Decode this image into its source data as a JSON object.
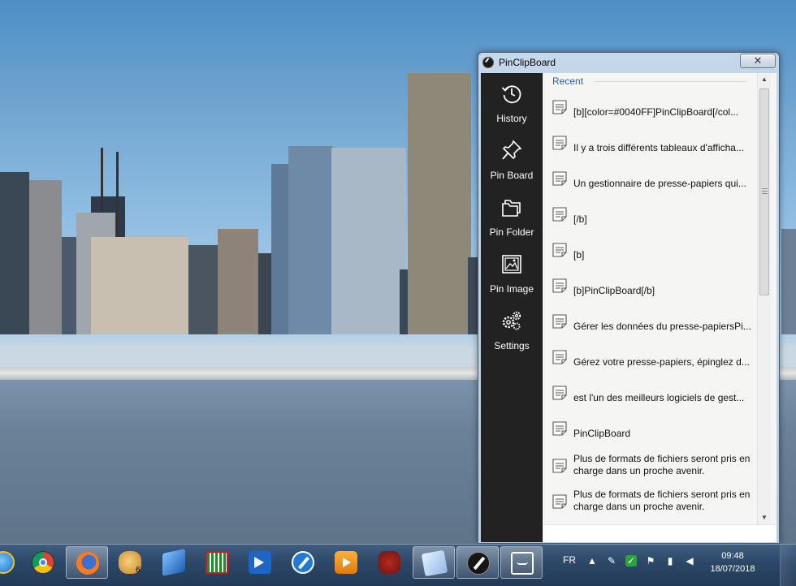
{
  "window": {
    "title": "PinClipBoard",
    "close_glyph": "✕"
  },
  "sidebar": {
    "items": [
      {
        "label": "History",
        "icon": "history-icon"
      },
      {
        "label": "Pin Board",
        "icon": "pin-icon"
      },
      {
        "label": "Pin Folder",
        "icon": "folder-icon"
      },
      {
        "label": "Pin Image",
        "icon": "image-icon"
      },
      {
        "label": "Settings",
        "icon": "gears-icon"
      }
    ]
  },
  "content": {
    "section_title": "Recent",
    "items": [
      {
        "text": "[b][color=#0040FF]PinClipBoard[/col..."
      },
      {
        "text": "Il y a trois différents tableaux d'afficha..."
      },
      {
        "text": "Un gestionnaire de presse-papiers qui..."
      },
      {
        "text": "[/b]"
      },
      {
        "text": "[b]"
      },
      {
        "text": "[b]PinClipBoard[/b]"
      },
      {
        "text": "Gérer les données du presse-papiersPi..."
      },
      {
        "text": "Gérez votre presse-papiers, épinglez d..."
      },
      {
        "text": "est l'un des meilleurs logiciels de gest..."
      },
      {
        "text": "PinClipBoard"
      },
      {
        "text": "Plus de formats de fichiers seront pris en charge dans un proche avenir."
      },
      {
        "text": " Plus de formats de fichiers seront pris en charge dans un proche avenir."
      }
    ]
  },
  "taskbar": {
    "apps": [
      {
        "name": "ie-icon"
      },
      {
        "name": "chrome-icon"
      },
      {
        "name": "firefox-icon"
      },
      {
        "name": "paint-icon"
      },
      {
        "name": "book-icon"
      },
      {
        "name": "grid-app-icon"
      },
      {
        "name": "teamviewer-icon"
      },
      {
        "name": "pen-icon"
      },
      {
        "name": "media-player-icon"
      },
      {
        "name": "gimp-icon"
      },
      {
        "name": "notebook-icon"
      },
      {
        "name": "pinclipboard-icon"
      },
      {
        "name": "monitor-icon"
      }
    ],
    "badge": "6",
    "language": "FR",
    "time": "09:48",
    "date": "18/07/2018"
  }
}
